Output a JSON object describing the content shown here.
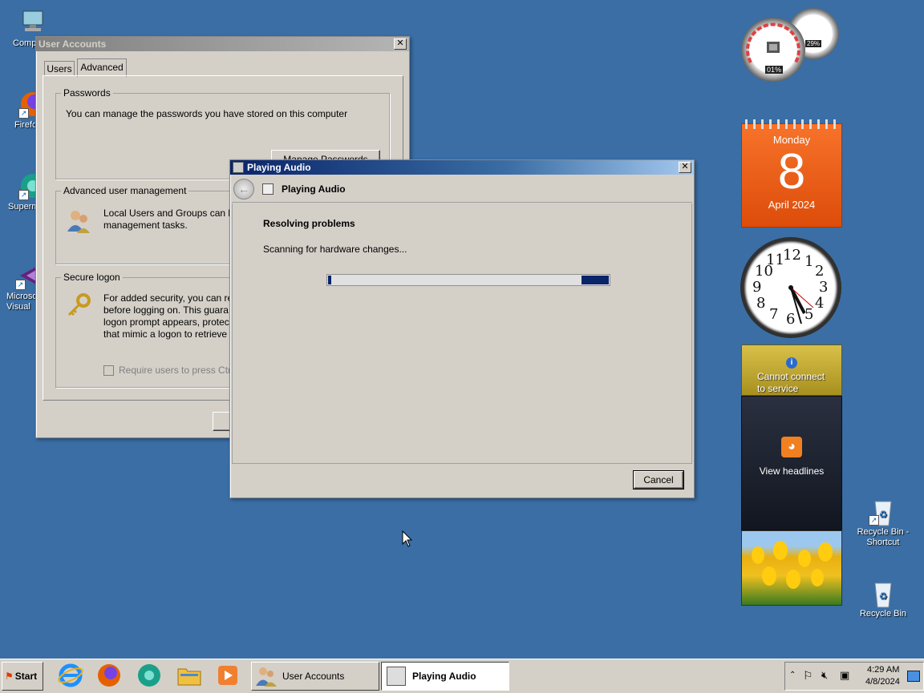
{
  "desktop": {
    "icons": [
      {
        "label": "Computer"
      },
      {
        "label": "Firefox"
      },
      {
        "label": "Supermium"
      },
      {
        "label": "Microsoft Visual Studio"
      },
      {
        "label": "Recycle Bin - Shortcut"
      },
      {
        "label": "Recycle Bin"
      }
    ]
  },
  "user_accounts": {
    "title": "User Accounts",
    "tabs": [
      "Users",
      "Advanced"
    ],
    "passwords": {
      "legend": "Passwords",
      "text": "You can manage the passwords you have stored on this computer",
      "button": "Manage Passwords"
    },
    "advanced_mgmt": {
      "legend": "Advanced user management",
      "text_line1": "Local Users and Groups can be",
      "text_line2": "management tasks."
    },
    "secure_logon": {
      "legend": "Secure logon",
      "lines": [
        "For added security, you can re",
        "before logging on. This guara",
        "logon prompt appears, protec",
        "that mimic a logon to retrieve"
      ],
      "checkbox_label": "Require users to press Ctrl-"
    }
  },
  "playing_audio": {
    "title": "Playing Audio",
    "nav_title": "Playing Audio",
    "heading": "Resolving problems",
    "status": "Scanning for hardware changes...",
    "cancel": "Cancel"
  },
  "gadgets": {
    "cpu": {
      "cpu_percent": "01%",
      "mem_percent": "29%"
    },
    "calendar": {
      "weekday": "Monday",
      "day": "8",
      "month_year": "April 2024"
    },
    "clock": {
      "numbers": [
        "12",
        "1",
        "2",
        "3",
        "4",
        "5",
        "6",
        "7",
        "8",
        "9",
        "10",
        "11"
      ]
    },
    "weather": {
      "message_line1": "Cannot connect",
      "message_line2": "to service"
    },
    "feed": {
      "label": "View headlines"
    }
  },
  "taskbar": {
    "start": "Start",
    "tasks": [
      {
        "label": "User Accounts"
      },
      {
        "label": "Playing Audio"
      }
    ],
    "tray": {
      "time": "4:29 AM",
      "date": "4/8/2024"
    }
  },
  "colors": {
    "desktop": "#3a6ea5",
    "active_title": "#0a246a",
    "calendar": "#f06520"
  }
}
